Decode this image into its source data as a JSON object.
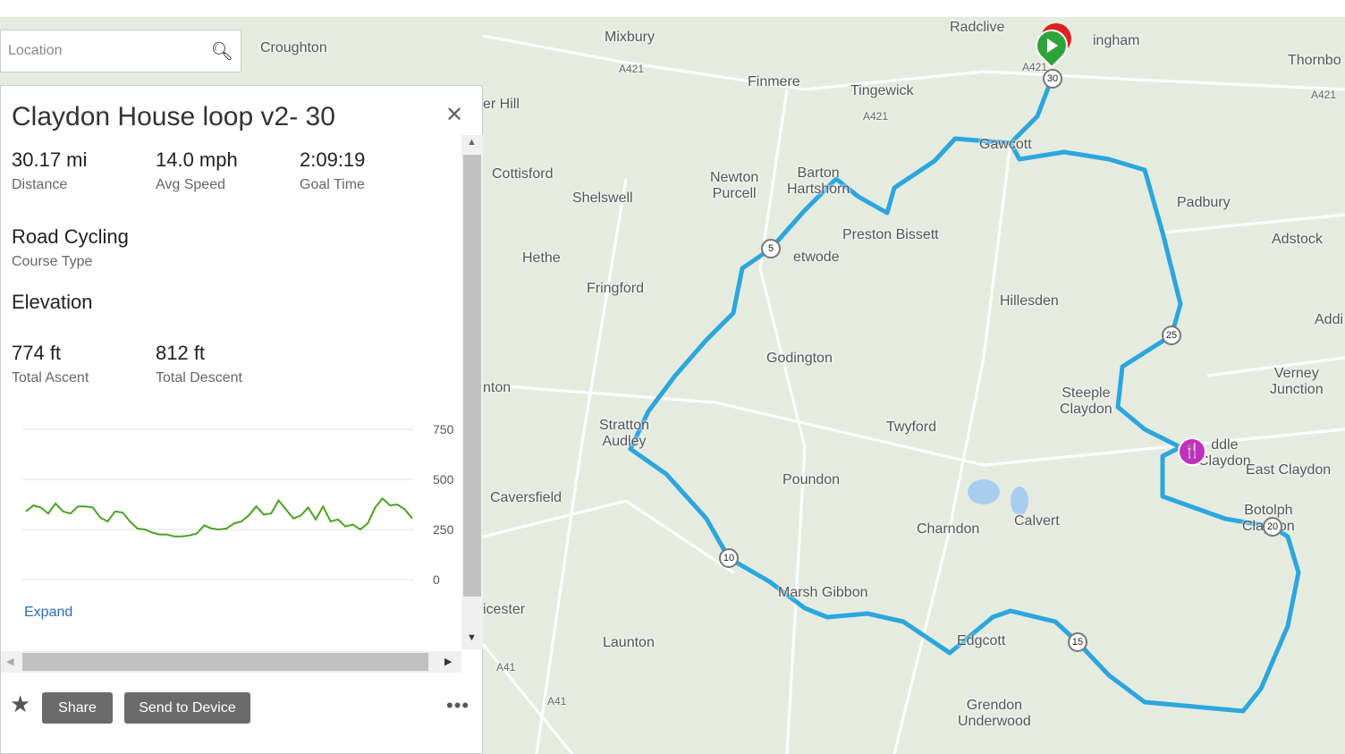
{
  "search": {
    "placeholder": "Location",
    "icon": "search-icon"
  },
  "course": {
    "title": "Claydon House loop v2- 30",
    "stats": [
      {
        "value": "30.17 mi",
        "label": "Distance"
      },
      {
        "value": "14.0 mph",
        "label": "Avg Speed"
      },
      {
        "value": "2:09:19",
        "label": "Goal Time"
      }
    ],
    "course_type": {
      "value": "Road Cycling",
      "label": "Course Type"
    },
    "elevation_heading": "Elevation",
    "elevation_stats": [
      {
        "value": "774 ft",
        "label": "Total Ascent"
      },
      {
        "value": "812 ft",
        "label": "Total Descent"
      }
    ],
    "expand_label": "Expand",
    "share_label": "Share",
    "send_label": "Send to Device"
  },
  "chart_data": {
    "type": "line",
    "ylim": [
      0,
      750
    ],
    "yticks": [
      "750",
      "500",
      "250",
      "0"
    ],
    "ytick_values": [
      750,
      500,
      250,
      0
    ],
    "grid": true,
    "color": "#4aa31e",
    "xlim": [
      0,
      30.17
    ],
    "values": [
      340,
      370,
      360,
      330,
      380,
      340,
      330,
      365,
      365,
      360,
      310,
      290,
      340,
      335,
      290,
      255,
      250,
      235,
      225,
      225,
      215,
      215,
      220,
      230,
      270,
      255,
      250,
      255,
      280,
      290,
      320,
      365,
      325,
      330,
      395,
      350,
      305,
      320,
      360,
      300,
      365,
      290,
      300,
      265,
      275,
      250,
      280,
      360,
      405,
      370,
      375,
      350,
      305
    ]
  },
  "map": {
    "route_color": "#2ba6de",
    "labels": [
      "Croughton",
      "Mixbury",
      "Radclive",
      "ingham",
      "Thornbo",
      "Finmere",
      "Tingewick",
      "er Hill",
      "Cottisford",
      "Shelswell",
      "Newton\nPurcell",
      "Barton\nHartshorn",
      "Gawcott",
      "Padbury",
      "Adstock",
      "Preston Bissett",
      "Hethe",
      "Fringford",
      "etwode",
      "Hillesden",
      "Addi",
      "Godington",
      "Steeple\nClaydon",
      "Verney\nJunction",
      "nton",
      "Stratton\nAudley",
      "Twyford",
      "ddle\nClaydon",
      "East Claydon",
      "Poundon",
      "Caversfield",
      "Charndon",
      "Calvert",
      "Botolph\nClaydon",
      "Marsh Gibbon",
      "icester",
      "Launton",
      "Edgcott",
      "Grendon\nUnderwood",
      "A421",
      "A421",
      "A421",
      "A421",
      "A41",
      "A41"
    ],
    "markers": [
      "5",
      "10",
      "15",
      "20",
      "25",
      "30"
    ]
  }
}
